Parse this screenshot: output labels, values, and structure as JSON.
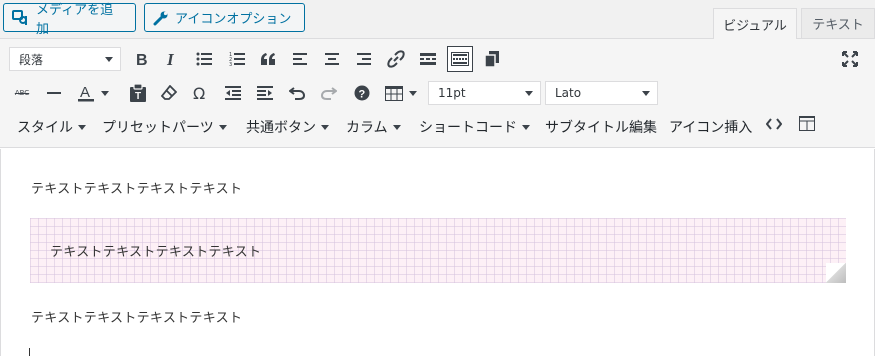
{
  "top_buttons": {
    "media_label": "メディアを追加",
    "icon_label": "アイコンオプション"
  },
  "tabs": {
    "visual": "ビジュアル",
    "text": "テキスト"
  },
  "toolbar": {
    "format_select": "段落",
    "font_size_select": "11pt",
    "font_family_select": "Lato",
    "menus": {
      "style": "スタイル",
      "preset": "プリセットパーツ",
      "common_button": "共通ボタン",
      "column": "カラム",
      "shortcode": "ショートコード",
      "subtitle_edit": "サブタイトル編集",
      "icon_insert": "アイコン挿入"
    },
    "strikethrough_icon_text": "ABC"
  },
  "content": {
    "para1": "テキストテキストテキストテキスト",
    "note": "テキストテキストテキストテキスト",
    "para3": "テキストテキストテキストテキスト"
  },
  "colors": {
    "accent": "#0071a1",
    "note_background": "#fdf0f6"
  }
}
